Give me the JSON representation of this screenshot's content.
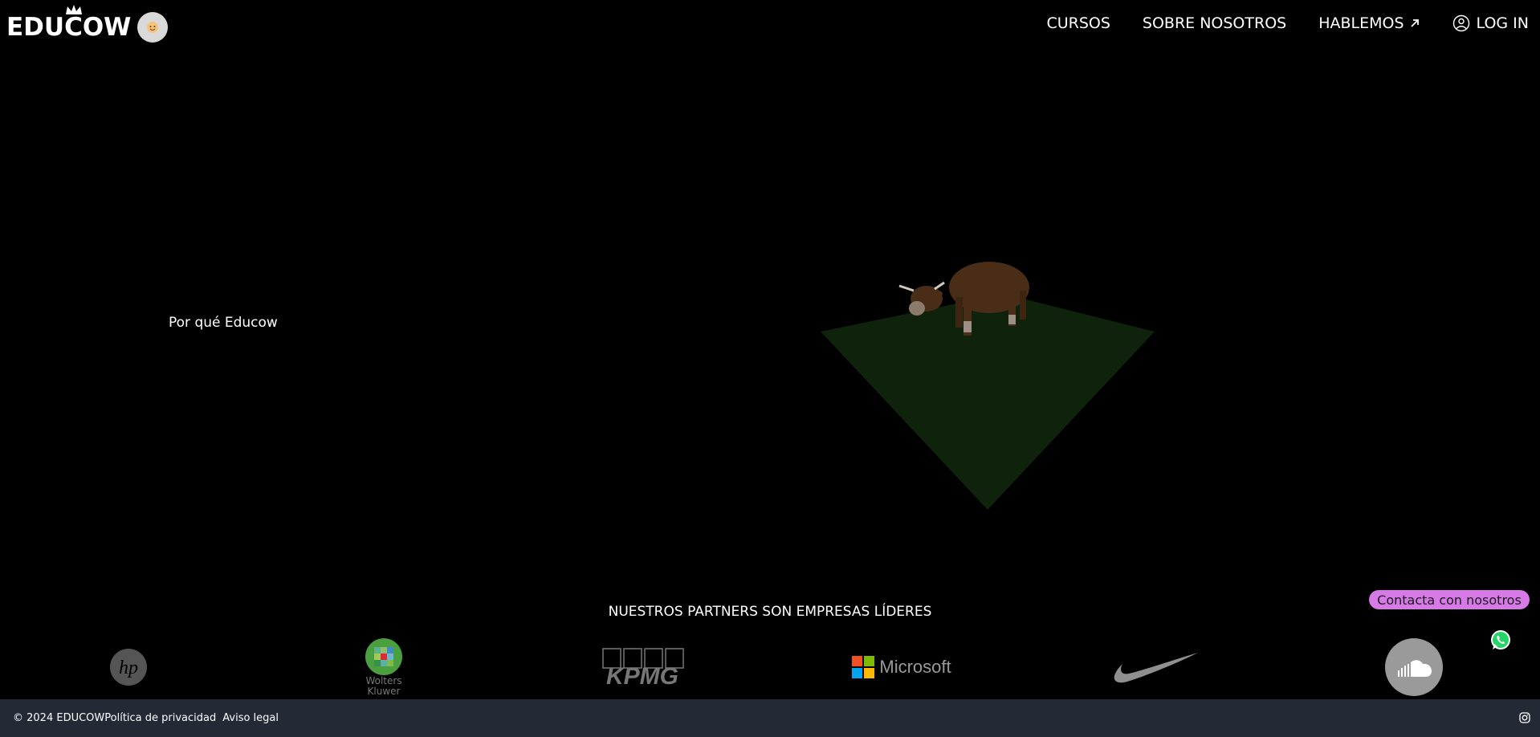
{
  "header": {
    "logo_text": "EDUCOW",
    "nav": {
      "courses": "CURSOS",
      "about": "SOBRE NOSOTROS",
      "talk": "HABLEMOS",
      "login": "LOG IN"
    }
  },
  "hero": {
    "why_text": "Por qué Educow"
  },
  "partners": {
    "title": "NUESTROS PARTNERS SON EMPRESAS LÍDERES",
    "logos": [
      "hp-logo",
      "wolters-kluwer-logo",
      "kpmg-logo",
      "microsoft-logo",
      "nike-logo",
      "soundcloud-logo"
    ],
    "wolters_line1": "Wolters",
    "wolters_line2": "Kluwer",
    "kpmg_text": "KPMG",
    "microsoft_text": "Microsoft",
    "hp_text": "hp"
  },
  "contact": {
    "label": "Contacta con nosotros"
  },
  "footer": {
    "copyright": "© 2024 EDUCOW",
    "privacy": "Política de privacidad",
    "legal": "Aviso legal"
  },
  "colors": {
    "background": "#000000",
    "footer": "#232935",
    "contact_pill": "#d879e8",
    "grass": "#0f220b",
    "cow": "#4a2d17"
  }
}
